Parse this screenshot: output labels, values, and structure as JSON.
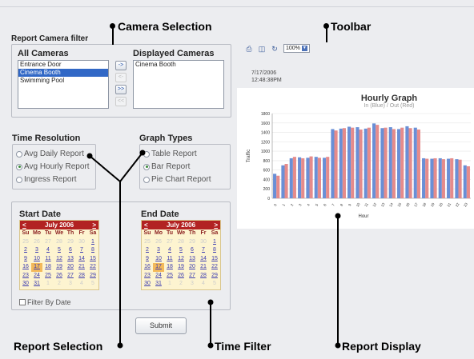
{
  "callouts": {
    "camera_selection": "Camera Selection",
    "toolbar": "Toolbar",
    "report_selection": "Report Selection",
    "time_filter": "Time Filter",
    "report_display": "Report Display"
  },
  "camera_filter": {
    "title": "Report Camera filter",
    "all_label": "All Cameras",
    "displayed_label": "Displayed Cameras",
    "all_cameras": [
      {
        "name": "Entrance Door",
        "selected": false
      },
      {
        "name": "Cinema Booth",
        "selected": true
      },
      {
        "name": "Swimming Pool",
        "selected": false
      }
    ],
    "displayed_cameras": [
      "Cinema Booth"
    ],
    "buttons": [
      {
        "label": "->",
        "enabled": true
      },
      {
        "label": "<-",
        "enabled": false
      },
      {
        "label": ">>",
        "enabled": true
      },
      {
        "label": "<<",
        "enabled": false
      }
    ]
  },
  "time_resolution": {
    "title": "Time Resolution",
    "options": [
      "Avg Daily Report",
      "Avg Hourly Report",
      "Ingress Report"
    ],
    "selected": 1
  },
  "graph_types": {
    "title": "Graph Types",
    "options": [
      "Table Report",
      "Bar Report",
      "Pie Chart Report"
    ],
    "selected": 1
  },
  "calendar": {
    "dow": [
      "Su",
      "Mo",
      "Tu",
      "We",
      "Th",
      "Fr",
      "Sa"
    ],
    "prev": "<",
    "next": ">",
    "month": "July 2006",
    "weeks": [
      [
        {
          "d": "25",
          "o": true
        },
        {
          "d": "26",
          "o": true
        },
        {
          "d": "27",
          "o": true
        },
        {
          "d": "28",
          "o": true
        },
        {
          "d": "29",
          "o": true
        },
        {
          "d": "30",
          "o": true
        },
        {
          "d": "1"
        }
      ],
      [
        {
          "d": "2"
        },
        {
          "d": "3"
        },
        {
          "d": "4"
        },
        {
          "d": "5"
        },
        {
          "d": "6"
        },
        {
          "d": "7"
        },
        {
          "d": "8"
        }
      ],
      [
        {
          "d": "9"
        },
        {
          "d": "10"
        },
        {
          "d": "11"
        },
        {
          "d": "12"
        },
        {
          "d": "13"
        },
        {
          "d": "14"
        },
        {
          "d": "15"
        }
      ],
      [
        {
          "d": "16"
        },
        {
          "d": "17",
          "t": true
        },
        {
          "d": "18"
        },
        {
          "d": "19"
        },
        {
          "d": "20"
        },
        {
          "d": "21"
        },
        {
          "d": "22"
        }
      ],
      [
        {
          "d": "23"
        },
        {
          "d": "24"
        },
        {
          "d": "25"
        },
        {
          "d": "26"
        },
        {
          "d": "27"
        },
        {
          "d": "28"
        },
        {
          "d": "29"
        }
      ],
      [
        {
          "d": "30"
        },
        {
          "d": "31"
        },
        {
          "d": "1",
          "o": true
        },
        {
          "d": "2",
          "o": true
        },
        {
          "d": "3",
          "o": true
        },
        {
          "d": "4",
          "o": true
        },
        {
          "d": "5",
          "o": true
        }
      ]
    ]
  },
  "time_filter": {
    "start_label": "Start Date",
    "end_label": "End Date",
    "filter_by_date": "Filter By Date",
    "filter_checked": false,
    "submit": "Submit"
  },
  "toolbar": {
    "icons": [
      "print-icon",
      "export-icon",
      "refresh-icon"
    ],
    "zoom": "100%"
  },
  "report": {
    "date": "7/17/2006",
    "time": "12:48:38PM"
  },
  "chart_data": {
    "type": "bar",
    "title": "Hourly Graph",
    "subtitle": "In (Blue) / Out (Red)",
    "ylabel": "Traffic",
    "xlabel": "Hour",
    "ylim": [
      0,
      1800
    ],
    "yticks": [
      0,
      200,
      400,
      600,
      800,
      1000,
      1200,
      1400,
      1600,
      1800
    ],
    "categories": [
      "0",
      "1",
      "2",
      "3",
      "4",
      "5",
      "6",
      "7",
      "8",
      "9",
      "10",
      "11",
      "12",
      "13",
      "14",
      "15",
      "16",
      "17",
      "18",
      "19",
      "20",
      "21",
      "22",
      "23"
    ],
    "series": [
      {
        "color": "#6a8fd6",
        "values": [
          520,
          700,
          850,
          870,
          860,
          880,
          860,
          1470,
          1480,
          1520,
          1510,
          1480,
          1590,
          1490,
          1510,
          1470,
          1530,
          1500,
          850,
          840,
          850,
          840,
          830,
          700
        ]
      },
      {
        "color": "#e58b8b",
        "values": [
          480,
          730,
          880,
          850,
          890,
          860,
          880,
          1440,
          1490,
          1500,
          1460,
          1500,
          1560,
          1500,
          1470,
          1500,
          1490,
          1460,
          840,
          850,
          830,
          850,
          820,
          680
        ]
      }
    ]
  }
}
